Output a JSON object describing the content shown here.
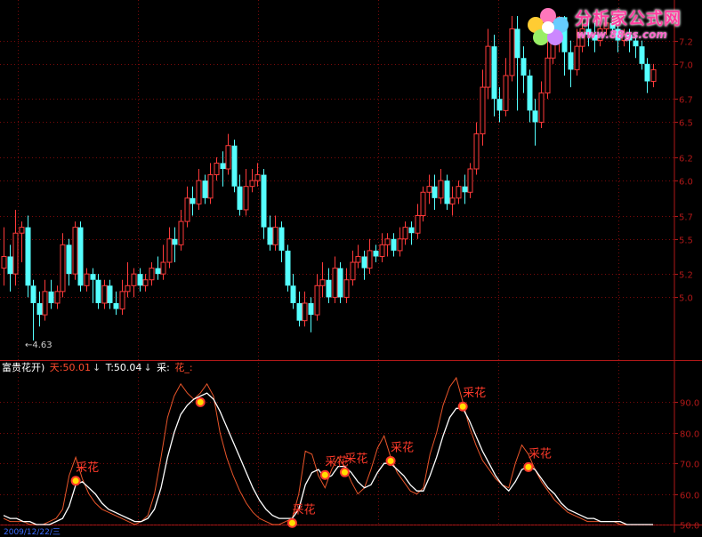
{
  "logo": {
    "brand": "分析家公式网",
    "url": "www.88gs.com"
  },
  "price_panel": {
    "low_marker_label": "←4.63"
  },
  "indicator_header": {
    "name": "富贵花开)",
    "tian_label": "天:50.01",
    "t_label": "T:50.04",
    "cai_label": "采:",
    "hua_label": "花_:"
  },
  "date_label": "2009/12/22/三",
  "colors": {
    "up": "#ff3a3a",
    "down": "#55ffff",
    "axis": "#b01818",
    "grid": "#7a0a0a",
    "tian_line": "#e9552a",
    "t_line": "#ffffff",
    "flower_text": "#ff3a2a",
    "flower_dot": "#ffdd00"
  },
  "chart_data": [
    {
      "type": "candlestick",
      "ylim": [
        4.63,
        7.41
      ],
      "yticks": [
        "7.2",
        "7.0",
        "6.7",
        "6.5",
        "6.2",
        "6.0",
        "5.7",
        "5.5",
        "5.2",
        "5.0"
      ],
      "candles": [
        [
          5.25,
          5.35,
          5.1,
          5.6
        ],
        [
          5.35,
          5.2,
          5.05,
          5.45
        ],
        [
          5.2,
          5.55,
          5.1,
          5.75
        ],
        [
          5.55,
          5.6,
          5.3,
          5.65
        ],
        [
          5.6,
          5.1,
          5.0,
          5.7
        ],
        [
          5.1,
          4.95,
          4.63,
          5.15
        ],
        [
          4.95,
          4.85,
          4.75,
          5.05
        ],
        [
          4.85,
          5.05,
          4.8,
          5.15
        ],
        [
          5.05,
          4.95,
          4.9,
          5.15
        ],
        [
          4.95,
          5.05,
          4.9,
          5.1
        ],
        [
          5.05,
          5.45,
          5.0,
          5.55
        ],
        [
          5.45,
          5.2,
          5.1,
          5.5
        ],
        [
          5.2,
          5.6,
          5.15,
          5.65
        ],
        [
          5.6,
          5.1,
          5.05,
          5.65
        ],
        [
          5.1,
          5.2,
          5.05,
          5.25
        ],
        [
          5.2,
          5.15,
          4.95,
          5.25
        ],
        [
          5.15,
          4.95,
          4.9,
          5.2
        ],
        [
          4.95,
          5.1,
          4.9,
          5.15
        ],
        [
          5.1,
          4.95,
          4.9,
          5.15
        ],
        [
          4.95,
          4.9,
          4.85,
          5.05
        ],
        [
          4.9,
          5.05,
          4.85,
          5.15
        ],
        [
          5.05,
          5.1,
          5.0,
          5.3
        ],
        [
          5.1,
          5.2,
          5.0,
          5.25
        ],
        [
          5.2,
          5.1,
          5.05,
          5.25
        ],
        [
          5.1,
          5.15,
          5.05,
          5.2
        ],
        [
          5.15,
          5.25,
          5.1,
          5.3
        ],
        [
          5.25,
          5.2,
          5.15,
          5.35
        ],
        [
          5.2,
          5.3,
          5.15,
          5.45
        ],
        [
          5.3,
          5.5,
          5.25,
          5.6
        ],
        [
          5.5,
          5.45,
          5.3,
          5.6
        ],
        [
          5.45,
          5.65,
          5.4,
          5.75
        ],
        [
          5.65,
          5.85,
          5.6,
          5.95
        ],
        [
          5.85,
          5.8,
          5.7,
          5.95
        ],
        [
          5.8,
          6.0,
          5.75,
          6.1
        ],
        [
          6.0,
          5.85,
          5.8,
          6.05
        ],
        [
          5.85,
          6.05,
          5.8,
          6.15
        ],
        [
          6.05,
          6.15,
          6.0,
          6.2
        ],
        [
          6.15,
          6.1,
          5.95,
          6.25
        ],
        [
          6.1,
          6.3,
          6.05,
          6.4
        ],
        [
          6.3,
          5.95,
          5.9,
          6.35
        ],
        [
          5.95,
          5.75,
          5.7,
          6.05
        ],
        [
          5.75,
          5.95,
          5.7,
          6.1
        ],
        [
          5.95,
          6.0,
          5.9,
          6.1
        ],
        [
          6.0,
          6.05,
          5.95,
          6.15
        ],
        [
          6.05,
          5.6,
          5.5,
          6.1
        ],
        [
          5.6,
          5.45,
          5.4,
          5.7
        ],
        [
          5.45,
          5.6,
          5.4,
          5.7
        ],
        [
          5.6,
          5.4,
          5.3,
          5.65
        ],
        [
          5.4,
          5.1,
          5.05,
          5.45
        ],
        [
          5.1,
          4.95,
          4.9,
          5.2
        ],
        [
          4.95,
          4.8,
          4.75,
          5.05
        ],
        [
          4.8,
          4.95,
          4.75,
          5.05
        ],
        [
          4.95,
          4.85,
          4.7,
          5.0
        ],
        [
          4.85,
          5.1,
          4.8,
          5.2
        ],
        [
          5.1,
          5.15,
          5.0,
          5.3
        ],
        [
          5.15,
          5.0,
          4.95,
          5.25
        ],
        [
          5.0,
          5.25,
          4.95,
          5.35
        ],
        [
          5.25,
          5.0,
          4.95,
          5.3
        ],
        [
          5.0,
          5.15,
          4.95,
          5.25
        ],
        [
          5.15,
          5.3,
          5.1,
          5.4
        ],
        [
          5.3,
          5.35,
          5.25,
          5.45
        ],
        [
          5.35,
          5.25,
          5.15,
          5.4
        ],
        [
          5.25,
          5.4,
          5.2,
          5.5
        ],
        [
          5.4,
          5.35,
          5.3,
          5.45
        ],
        [
          5.35,
          5.45,
          5.3,
          5.55
        ],
        [
          5.45,
          5.5,
          5.35,
          5.55
        ],
        [
          5.5,
          5.4,
          5.35,
          5.55
        ],
        [
          5.4,
          5.5,
          5.35,
          5.6
        ],
        [
          5.5,
          5.6,
          5.45,
          5.65
        ],
        [
          5.6,
          5.55,
          5.45,
          5.65
        ],
        [
          5.55,
          5.7,
          5.5,
          5.8
        ],
        [
          5.7,
          5.9,
          5.65,
          5.95
        ],
        [
          5.9,
          5.95,
          5.8,
          6.05
        ],
        [
          5.95,
          5.85,
          5.75,
          6.05
        ],
        [
          5.85,
          6.0,
          5.8,
          6.1
        ],
        [
          6.0,
          5.8,
          5.75,
          6.05
        ],
        [
          5.8,
          5.85,
          5.7,
          5.95
        ],
        [
          5.85,
          5.95,
          5.8,
          6.0
        ],
        [
          5.95,
          5.9,
          5.8,
          6.05
        ],
        [
          5.9,
          6.1,
          5.85,
          6.15
        ],
        [
          6.1,
          6.4,
          6.05,
          6.5
        ],
        [
          6.4,
          6.8,
          6.3,
          6.95
        ],
        [
          6.8,
          7.15,
          6.7,
          7.3
        ],
        [
          7.15,
          6.7,
          6.55,
          7.25
        ],
        [
          6.7,
          6.6,
          6.5,
          6.8
        ],
        [
          6.6,
          6.9,
          6.55,
          7.05
        ],
        [
          6.9,
          7.3,
          6.85,
          7.41
        ],
        [
          7.3,
          7.05,
          6.6,
          7.41
        ],
        [
          7.05,
          6.9,
          6.75,
          7.15
        ],
        [
          6.9,
          6.6,
          6.5,
          6.95
        ],
        [
          6.6,
          6.5,
          6.3,
          6.7
        ],
        [
          6.5,
          6.75,
          6.45,
          6.85
        ],
        [
          6.75,
          7.05,
          6.7,
          7.2
        ],
        [
          7.05,
          7.2,
          7.0,
          7.35
        ],
        [
          7.2,
          7.4,
          7.1,
          7.41
        ],
        [
          7.4,
          7.1,
          6.9,
          7.41
        ],
        [
          7.1,
          6.95,
          6.8,
          7.2
        ],
        [
          6.95,
          7.15,
          6.9,
          7.3
        ],
        [
          7.15,
          7.3,
          7.1,
          7.41
        ],
        [
          7.3,
          7.25,
          7.15,
          7.4
        ],
        [
          7.25,
          7.2,
          7.1,
          7.35
        ],
        [
          7.2,
          7.3,
          7.15,
          7.4
        ],
        [
          7.3,
          7.35,
          7.25,
          7.41
        ],
        [
          7.35,
          7.3,
          7.25,
          7.41
        ],
        [
          7.3,
          7.2,
          7.1,
          7.35
        ],
        [
          7.2,
          7.25,
          7.15,
          7.3
        ],
        [
          7.25,
          7.2,
          7.1,
          7.3
        ],
        [
          7.2,
          7.15,
          7.05,
          7.25
        ],
        [
          7.15,
          7.0,
          6.95,
          7.2
        ],
        [
          7.0,
          6.85,
          6.75,
          7.05
        ],
        [
          6.85,
          6.95,
          6.8,
          7.0
        ]
      ]
    },
    {
      "type": "line",
      "ylim": [
        50,
        100
      ],
      "yticks": [
        "90.0",
        "80.0",
        "70.0",
        "60.0",
        "50.0"
      ],
      "series": [
        {
          "name": "天",
          "values": [
            52,
            51,
            51,
            51,
            50,
            50,
            50,
            51,
            52,
            55,
            66,
            72,
            65,
            60,
            57,
            55,
            54,
            53,
            52,
            51,
            50,
            51,
            53,
            60,
            72,
            85,
            92,
            96,
            93,
            91,
            93,
            96,
            92,
            80,
            72,
            66,
            61,
            57,
            54,
            52,
            51,
            50,
            50,
            51,
            52,
            60,
            74,
            73,
            66,
            62,
            68,
            72,
            69,
            64,
            60,
            62,
            68,
            75,
            79,
            72,
            67,
            64,
            61,
            60,
            62,
            73,
            80,
            89,
            95,
            98,
            90,
            82,
            76,
            71,
            68,
            65,
            63,
            62,
            70,
            76,
            73,
            68,
            64,
            61,
            58,
            56,
            54,
            53,
            52,
            51,
            51,
            51,
            51,
            51,
            50,
            50,
            50,
            50,
            50,
            50
          ]
        },
        {
          "name": "T",
          "values": [
            53,
            52,
            52,
            51,
            51,
            50,
            50,
            50,
            51,
            52,
            56,
            63,
            64,
            62,
            60,
            57,
            55,
            54,
            53,
            52,
            51,
            51,
            52,
            55,
            62,
            72,
            80,
            86,
            89,
            91,
            92,
            93,
            91,
            87,
            82,
            77,
            72,
            67,
            62,
            58,
            55,
            53,
            52,
            52,
            52,
            55,
            63,
            67,
            68,
            65,
            66,
            69,
            69,
            67,
            64,
            62,
            63,
            67,
            70,
            70,
            68,
            66,
            63,
            61,
            61,
            66,
            72,
            79,
            85,
            88,
            88,
            84,
            79,
            74,
            70,
            66,
            63,
            61,
            64,
            68,
            69,
            68,
            65,
            62,
            60,
            57,
            55,
            54,
            53,
            52,
            52,
            51,
            51,
            51,
            51,
            50,
            50,
            50,
            50,
            50
          ]
        }
      ],
      "flowers": [
        {
          "index": 11,
          "value": 64.3,
          "label": "采花"
        },
        {
          "index": 30,
          "value": 90.0,
          "label": ""
        },
        {
          "index": 44,
          "value": 50.5,
          "label": "采花"
        },
        {
          "index": 49,
          "value": 66.2,
          "label": "采花"
        },
        {
          "index": 52,
          "value": 67.1,
          "label": "采花"
        },
        {
          "index": 59,
          "value": 70.8,
          "label": "采花"
        },
        {
          "index": 70,
          "value": 88.6,
          "label": "采花"
        },
        {
          "index": 80,
          "value": 68.8,
          "label": "采花"
        }
      ]
    }
  ]
}
